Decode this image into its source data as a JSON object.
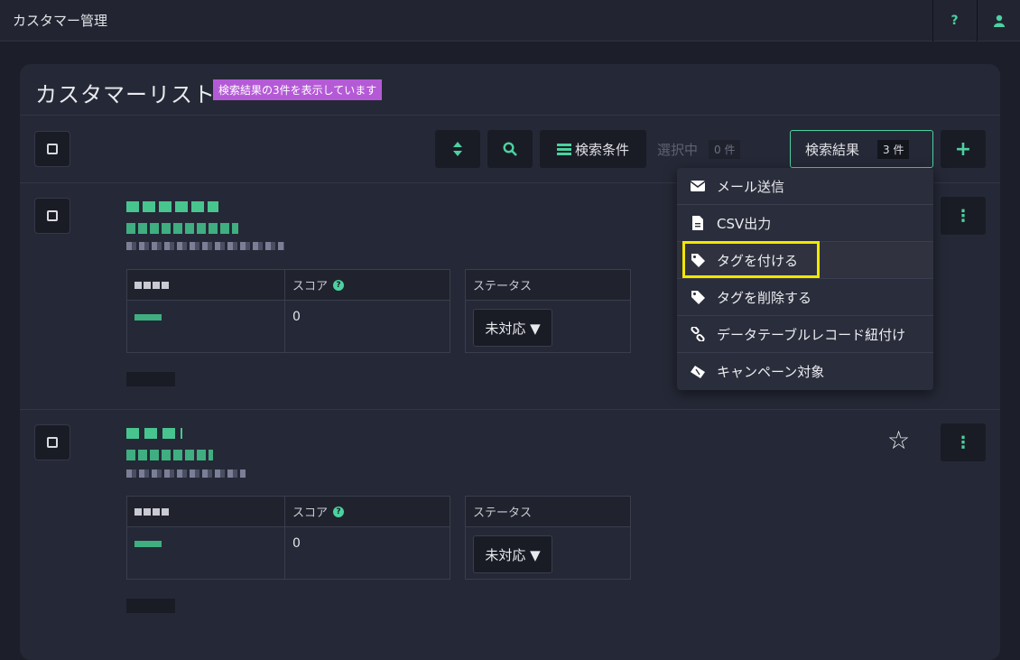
{
  "app": {
    "title": "カスタマー管理"
  },
  "topbar": {
    "help_label": "?",
    "user_label": "👤"
  },
  "panel": {
    "title": "カスタマーリスト",
    "badge": "検索結果の3件を表示しています"
  },
  "toolbar": {
    "sort_icon": "⇕",
    "search_icon": "⌕",
    "conditions_label": "検索条件",
    "selected_label": "選択中",
    "selected_count": "0 件",
    "results_label": "検索結果",
    "results_count": "3 件",
    "add_label": "+"
  },
  "records": [
    {
      "fields": {
        "col1_value": "",
        "score_label": "スコア",
        "score_value": "0",
        "status_label": "ステータス",
        "status_value": "未対応 ▼"
      }
    },
    {
      "fields": {
        "col1_value": "",
        "score_label": "スコア",
        "score_value": "0",
        "status_label": "ステータス",
        "status_value": "未対応 ▼"
      }
    }
  ],
  "menu": {
    "items": [
      {
        "label": "メール送信",
        "icon": "envelope-icon"
      },
      {
        "label": "CSV出力",
        "icon": "file-icon"
      },
      {
        "label": "タグを付ける",
        "icon": "tag-icon"
      },
      {
        "label": "タグを削除する",
        "icon": "tag-icon"
      },
      {
        "label": "データテーブルレコード紐付け",
        "icon": "link-icon"
      },
      {
        "label": "キャンペーン対象",
        "icon": "ticket-icon"
      }
    ]
  },
  "colors": {
    "accent": "#4cd1a0",
    "badge": "#b45ad6",
    "highlight": "#f3e800",
    "background": "#1c1f29"
  }
}
